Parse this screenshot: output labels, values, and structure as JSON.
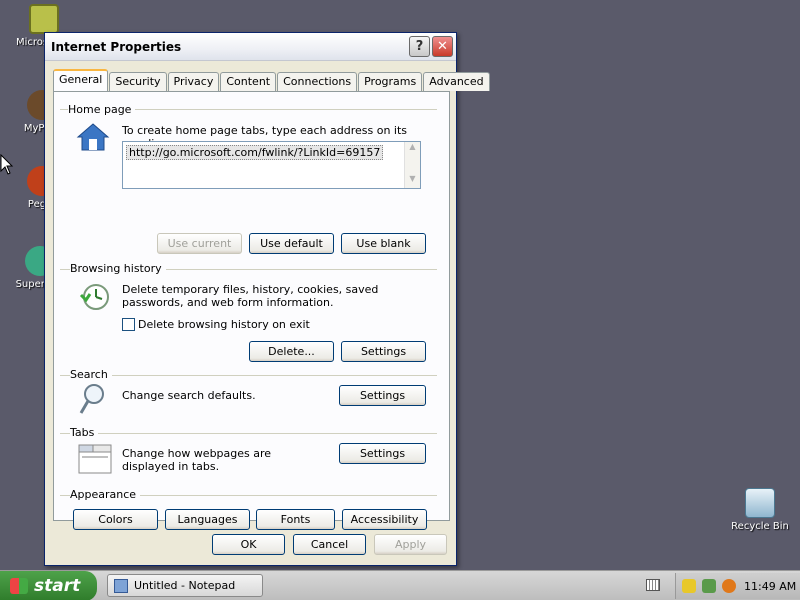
{
  "desktop": {
    "icons": [
      {
        "label": "Microsoft Outlook",
        "icon": "outlook-icon"
      },
      {
        "label": "MyPa…",
        "icon": "mypaint-icon"
      },
      {
        "label": "Peg…",
        "icon": "pegasus-icon"
      },
      {
        "label": "Superm…",
        "icon": "supermario-icon"
      },
      {
        "label": "Recycle Bin",
        "icon": "recycle-bin-icon"
      }
    ]
  },
  "window": {
    "title": "Internet Properties",
    "help_glyph": "?",
    "close_glyph": "✕",
    "tabs": [
      "General",
      "Security",
      "Privacy",
      "Content",
      "Connections",
      "Programs",
      "Advanced"
    ],
    "active_tab": "General",
    "home_page": {
      "title": "Home page",
      "description": "To create home page tabs, type each address on its own line.",
      "url": "http://go.microsoft.com/fwlink/?LinkId=69157",
      "buttons": {
        "use_current": "Use current",
        "use_default": "Use default",
        "use_blank": "Use blank"
      }
    },
    "browsing_history": {
      "title": "Browsing history",
      "description": "Delete temporary files, history, cookies, saved passwords, and web form information.",
      "checkbox_label": "Delete browsing history on exit",
      "checkbox_checked": false,
      "buttons": {
        "delete": "Delete...",
        "settings": "Settings"
      }
    },
    "search": {
      "title": "Search",
      "description": "Change search defaults.",
      "settings": "Settings"
    },
    "tabs_section": {
      "title": "Tabs",
      "description": "Change how webpages are displayed in tabs.",
      "settings": "Settings"
    },
    "appearance": {
      "title": "Appearance",
      "buttons": [
        "Colors",
        "Languages",
        "Fonts",
        "Accessibility"
      ]
    },
    "footer": {
      "ok": "OK",
      "cancel": "Cancel",
      "apply": "Apply"
    }
  },
  "taskbar": {
    "start_label": "start",
    "task": "Untitled - Notepad",
    "clock": "11:49 AM"
  },
  "colors": {
    "desktop": "#5a5a6a",
    "window_bg": "#ece9d8",
    "tab_highlight": "#f9b641"
  }
}
